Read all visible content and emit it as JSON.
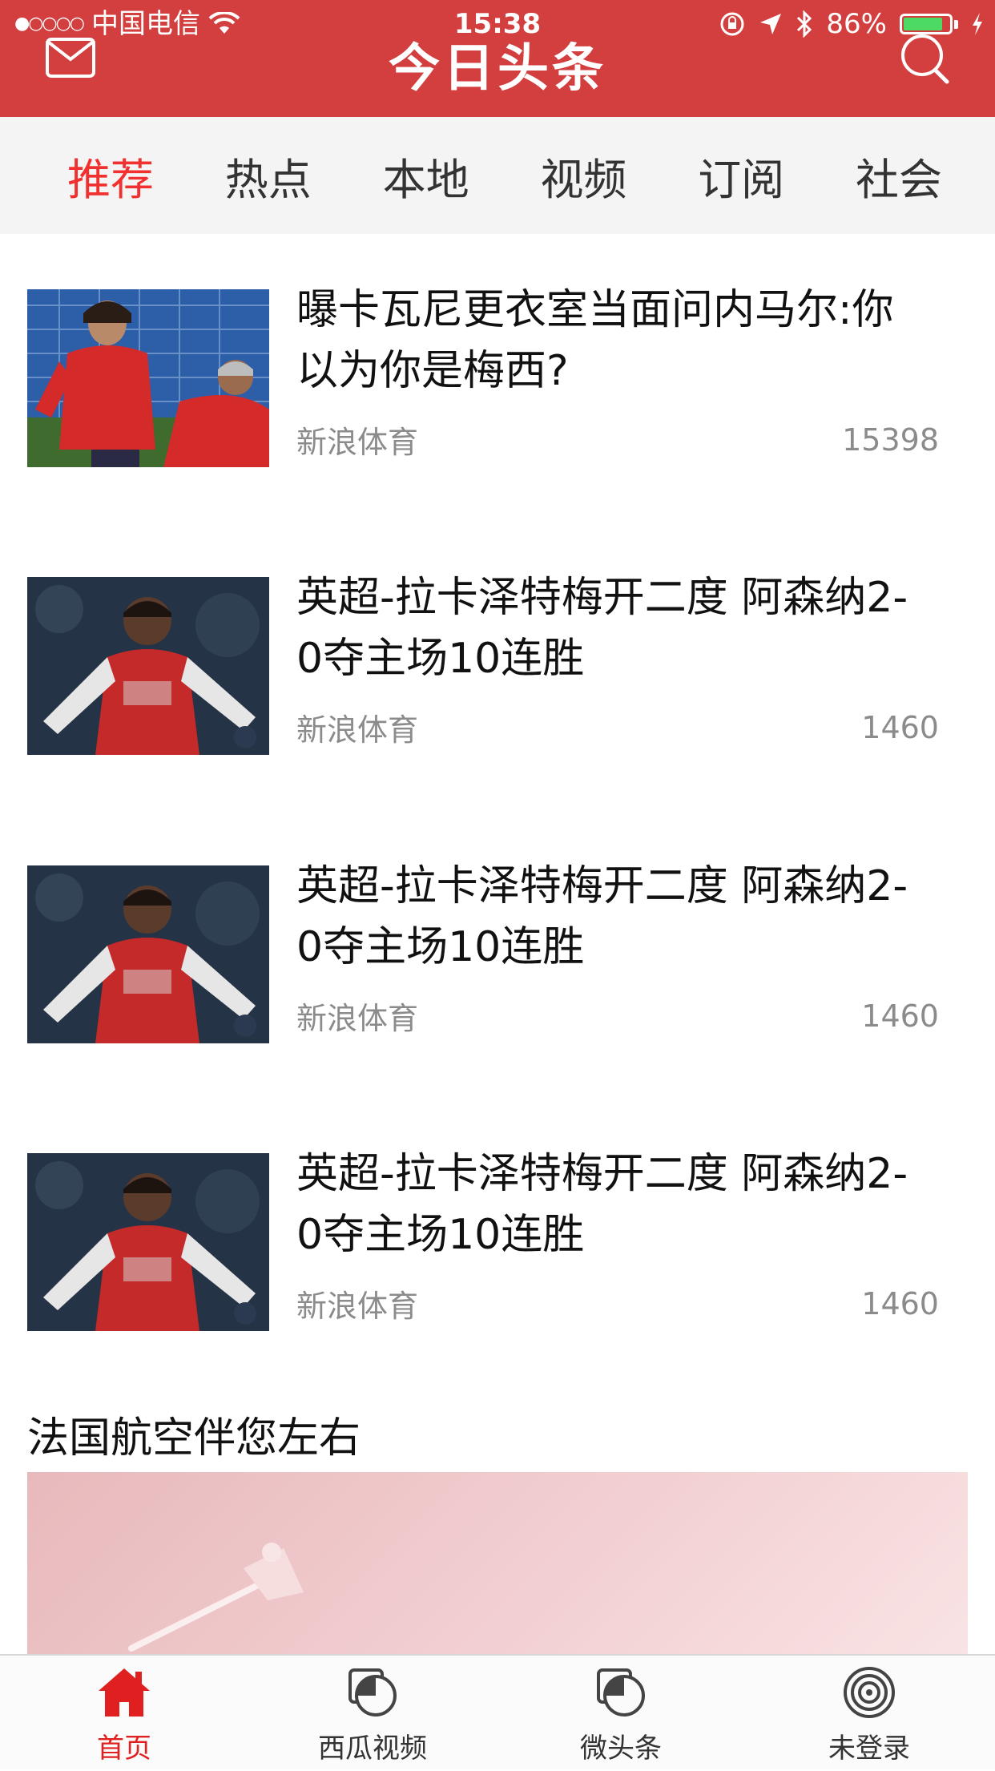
{
  "status_bar": {
    "signal": "●○○○○",
    "carrier": "中国电信",
    "time": "15:38",
    "battery_percent": "86%",
    "battery_level": 0.86
  },
  "header": {
    "logo": "今日头条",
    "mail_icon": "mail-icon",
    "search_icon": "search-icon",
    "background_color": "#d33f3f"
  },
  "tabs": [
    {
      "label": "推荐",
      "active": true
    },
    {
      "label": "热点",
      "active": false
    },
    {
      "label": "本地",
      "active": false
    },
    {
      "label": "视频",
      "active": false
    },
    {
      "label": "订阅",
      "active": false
    },
    {
      "label": "社会",
      "active": false
    }
  ],
  "news": [
    {
      "title": "曝卡瓦尼更衣室当面问内马尔:你以为你是梅西?",
      "source": "新浪体育",
      "count": "15398"
    },
    {
      "title": "英超-拉卡泽特梅开二度 阿森纳2-0夺主场10连胜",
      "source": "新浪体育",
      "count": "1460"
    },
    {
      "title": "英超-拉卡泽特梅开二度 阿森纳2-0夺主场10连胜",
      "source": "新浪体育",
      "count": "1460"
    },
    {
      "title": "英超-拉卡泽特梅开二度 阿森纳2-0夺主场10连胜",
      "source": "新浪体育",
      "count": "1460"
    }
  ],
  "ad": {
    "title": "法国航空伴您左右"
  },
  "tabbar": [
    {
      "label": "首页",
      "icon": "home-icon",
      "active": true
    },
    {
      "label": "西瓜视频",
      "icon": "video-icon",
      "active": false
    },
    {
      "label": "微头条",
      "icon": "micro-headline-icon",
      "active": false
    },
    {
      "label": "未登录",
      "icon": "profile-icon",
      "active": false
    }
  ],
  "colors": {
    "accent": "#d33f3f",
    "active_tab": "#f23030",
    "secondary_text": "#8b8b8b"
  }
}
